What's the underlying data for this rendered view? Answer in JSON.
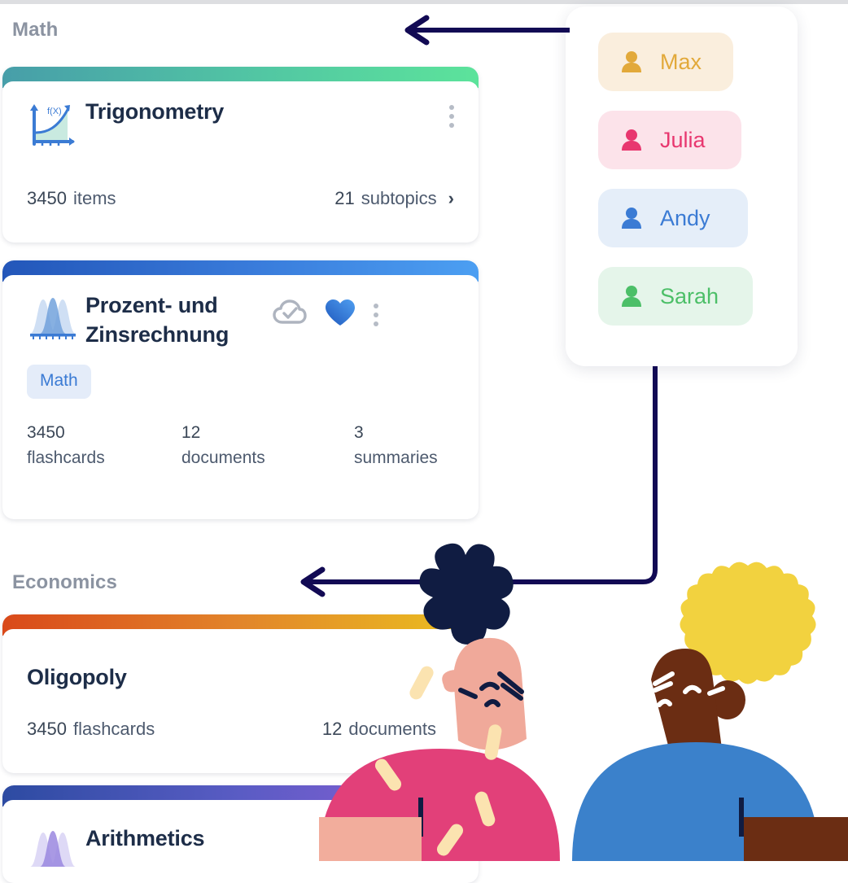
{
  "sections": [
    {
      "id": "math",
      "title": "Math"
    },
    {
      "id": "economics",
      "title": "Economics"
    }
  ],
  "cards": {
    "trigonometry": {
      "title": "Trigonometry",
      "icon": "function-graph-icon",
      "accent_from": "#479ea9",
      "accent_to": "#5ce39b",
      "items_count": "3450",
      "items_label": "items",
      "subtopics_count": "21",
      "subtopics_label": "subtopics",
      "chevron": "›",
      "menu": "more-options"
    },
    "prozent": {
      "title": "Prozent- und Zinsrechnung",
      "icon": "distribution-curve-icon",
      "accent_from": "#2356b9",
      "accent_to": "#4c9ff2",
      "tag": "Math",
      "cloud_status": "synced",
      "favorite": "true",
      "stats": [
        {
          "value": "3450",
          "label": "flashcards"
        },
        {
          "value": "12",
          "label": "documents"
        },
        {
          "value": "3",
          "label": "summaries"
        }
      ]
    },
    "oligopoly": {
      "title": "Oligopoly",
      "accent_from": "#d9491a",
      "accent_to": "#ebc11f",
      "flashcards_count": "3450",
      "flashcards_label": "flashcards",
      "documents_count": "12",
      "documents_label": "documents"
    },
    "arithmetics": {
      "title": "Arithmetics",
      "icon": "distribution-curve-icon",
      "accent_from": "#2d4ba2",
      "accent_to": "#8f5fd8"
    }
  },
  "user_panel": {
    "users": [
      {
        "name": "Max",
        "color": "#e2a93a",
        "bg": "#faeedd",
        "icon": "person-icon"
      },
      {
        "name": "Julia",
        "color": "#e8376f",
        "bg": "#fce3ea",
        "icon": "person-icon"
      },
      {
        "name": "Andy",
        "color": "#3b7bd4",
        "bg": "#e5eef9",
        "icon": "person-icon"
      },
      {
        "name": "Sarah",
        "color": "#4cbf68",
        "bg": "#e5f5ea",
        "icon": "person-icon"
      }
    ]
  },
  "annotations": {
    "arrow_color": "#120a54",
    "arrow_top": "points from user panel to Math section",
    "arrow_bottom": "points from user panel down to Economics section"
  },
  "illustration": {
    "left_character": {
      "hair": "#101c42",
      "skin": "#f0a99a",
      "shirt": "#e24079"
    },
    "right_character": {
      "hair_outer": "#f2d23f",
      "face": "#6b2d13",
      "shirt": "#3b81cb"
    }
  }
}
